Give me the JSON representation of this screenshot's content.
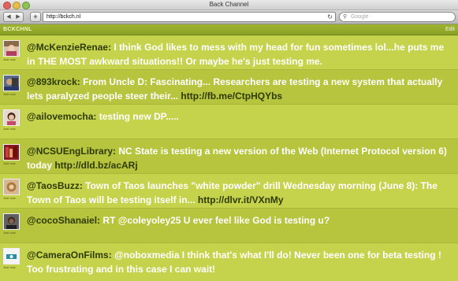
{
  "window": {
    "title": "Back Channel"
  },
  "toolbar": {
    "back_glyph": "◀",
    "forward_glyph": "▶",
    "add_glyph": "+",
    "url": "http://bckch.nl",
    "reload_glyph": "↻",
    "search_placeholder": "Google",
    "search_glyph": "⚲"
  },
  "app": {
    "title": "BCKCHNL",
    "edit_label": "Edit"
  },
  "tweets": [
    {
      "user": "@McKenzieRenae:",
      "text": " I think God likes to mess with my head for fun sometimes lol...he puts me in THE MOST awkward situations!! Or maybe he's just testing me.",
      "link": "",
      "meta": "Just now"
    },
    {
      "user": "@893krock:",
      "text": " From Uncle D: Fascinating... Researchers are testing a new system that actually lets paralyzed people steer their... ",
      "link": "http://fb.me/CtpHQYbs",
      "meta": "Just now"
    },
    {
      "user": "@ailovemocha:",
      "text": " testing new DP.....",
      "link": "",
      "meta": "Just now"
    },
    {
      "user": "@NCSUEngLibrary:",
      "text": " NC State is testing a new version of the Web (Internet Protocol version 6) today ",
      "link": "http://dld.bz/acARj",
      "meta": "Just now"
    },
    {
      "user": "@TaosBuzz:",
      "text": " Town of Taos launches \"white powder\" drill Wednesday morning (June 8): The Town of Taos will be testing itself in... ",
      "link": "http://dlvr.it/VXnMy",
      "meta": "Just now"
    },
    {
      "user": "@cocoShanaiel:",
      "text": " RT @coleyoley25 U ever feel like God is testing u?",
      "link": "",
      "meta": "Just now"
    },
    {
      "user": "@CameraOnFilms:",
      "text": " @noboxmedia I think that's what I'll do! Never been one for beta testing ! Too frustrating and in this case I can wait!",
      "link": "",
      "meta": "Just now"
    }
  ],
  "colors": {
    "row_odd": "#c5d34c",
    "row_even": "#b6c43e",
    "accent": "#2f3a05"
  }
}
